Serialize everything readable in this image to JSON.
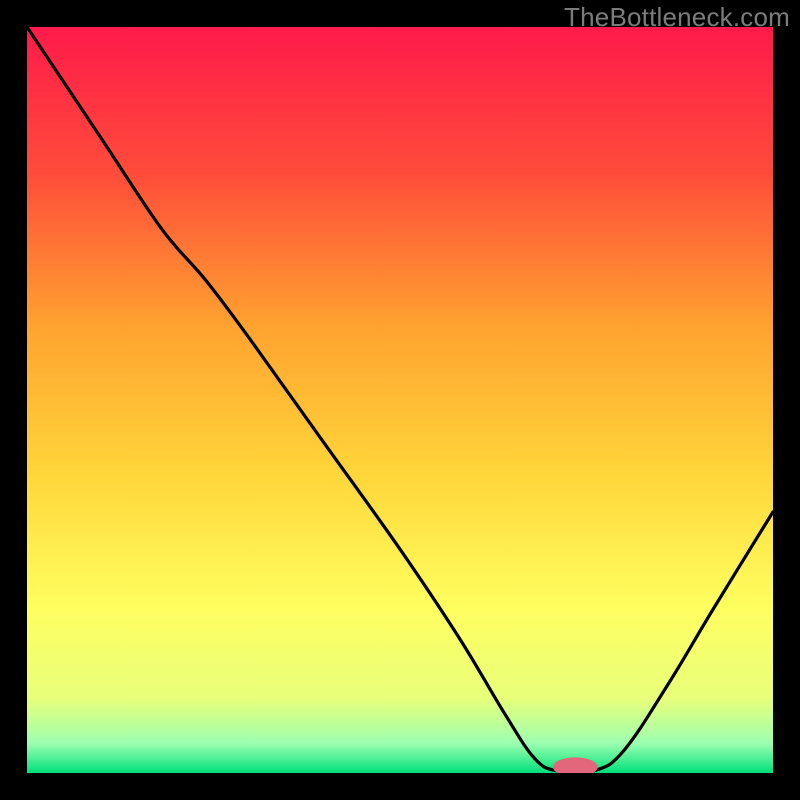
{
  "watermark": "TheBottleneck.com",
  "chart_data": {
    "type": "line",
    "title": "",
    "xlabel": "",
    "ylabel": "",
    "xlim": [
      0,
      100
    ],
    "ylim": [
      0,
      100
    ],
    "gradient_stops": [
      {
        "offset": 0,
        "color": "#ff1a4a"
      },
      {
        "offset": 20,
        "color": "#ff4d3a"
      },
      {
        "offset": 40,
        "color": "#ffa22f"
      },
      {
        "offset": 60,
        "color": "#ffd63a"
      },
      {
        "offset": 78,
        "color": "#ffff60"
      },
      {
        "offset": 90,
        "color": "#e8ff7a"
      },
      {
        "offset": 96,
        "color": "#9dffb0"
      },
      {
        "offset": 100,
        "color": "#00e07a"
      }
    ],
    "series": [
      {
        "name": "bottleneck-curve",
        "color": "#000000",
        "points": [
          {
            "x": 0,
            "y": 100
          },
          {
            "x": 10,
            "y": 85
          },
          {
            "x": 18,
            "y": 73
          },
          {
            "x": 24,
            "y": 66
          },
          {
            "x": 30,
            "y": 58
          },
          {
            "x": 40,
            "y": 44
          },
          {
            "x": 50,
            "y": 30
          },
          {
            "x": 58,
            "y": 18
          },
          {
            "x": 64,
            "y": 8
          },
          {
            "x": 68,
            "y": 2
          },
          {
            "x": 71,
            "y": 0.3
          },
          {
            "x": 76,
            "y": 0.3
          },
          {
            "x": 80,
            "y": 3
          },
          {
            "x": 86,
            "y": 12
          },
          {
            "x": 92,
            "y": 22
          },
          {
            "x": 100,
            "y": 35
          }
        ]
      }
    ],
    "marker": {
      "name": "optimal-point",
      "color": "#e2677a",
      "x": 73.5,
      "y": 0.8,
      "rx": 3.0,
      "ry": 1.3
    }
  }
}
